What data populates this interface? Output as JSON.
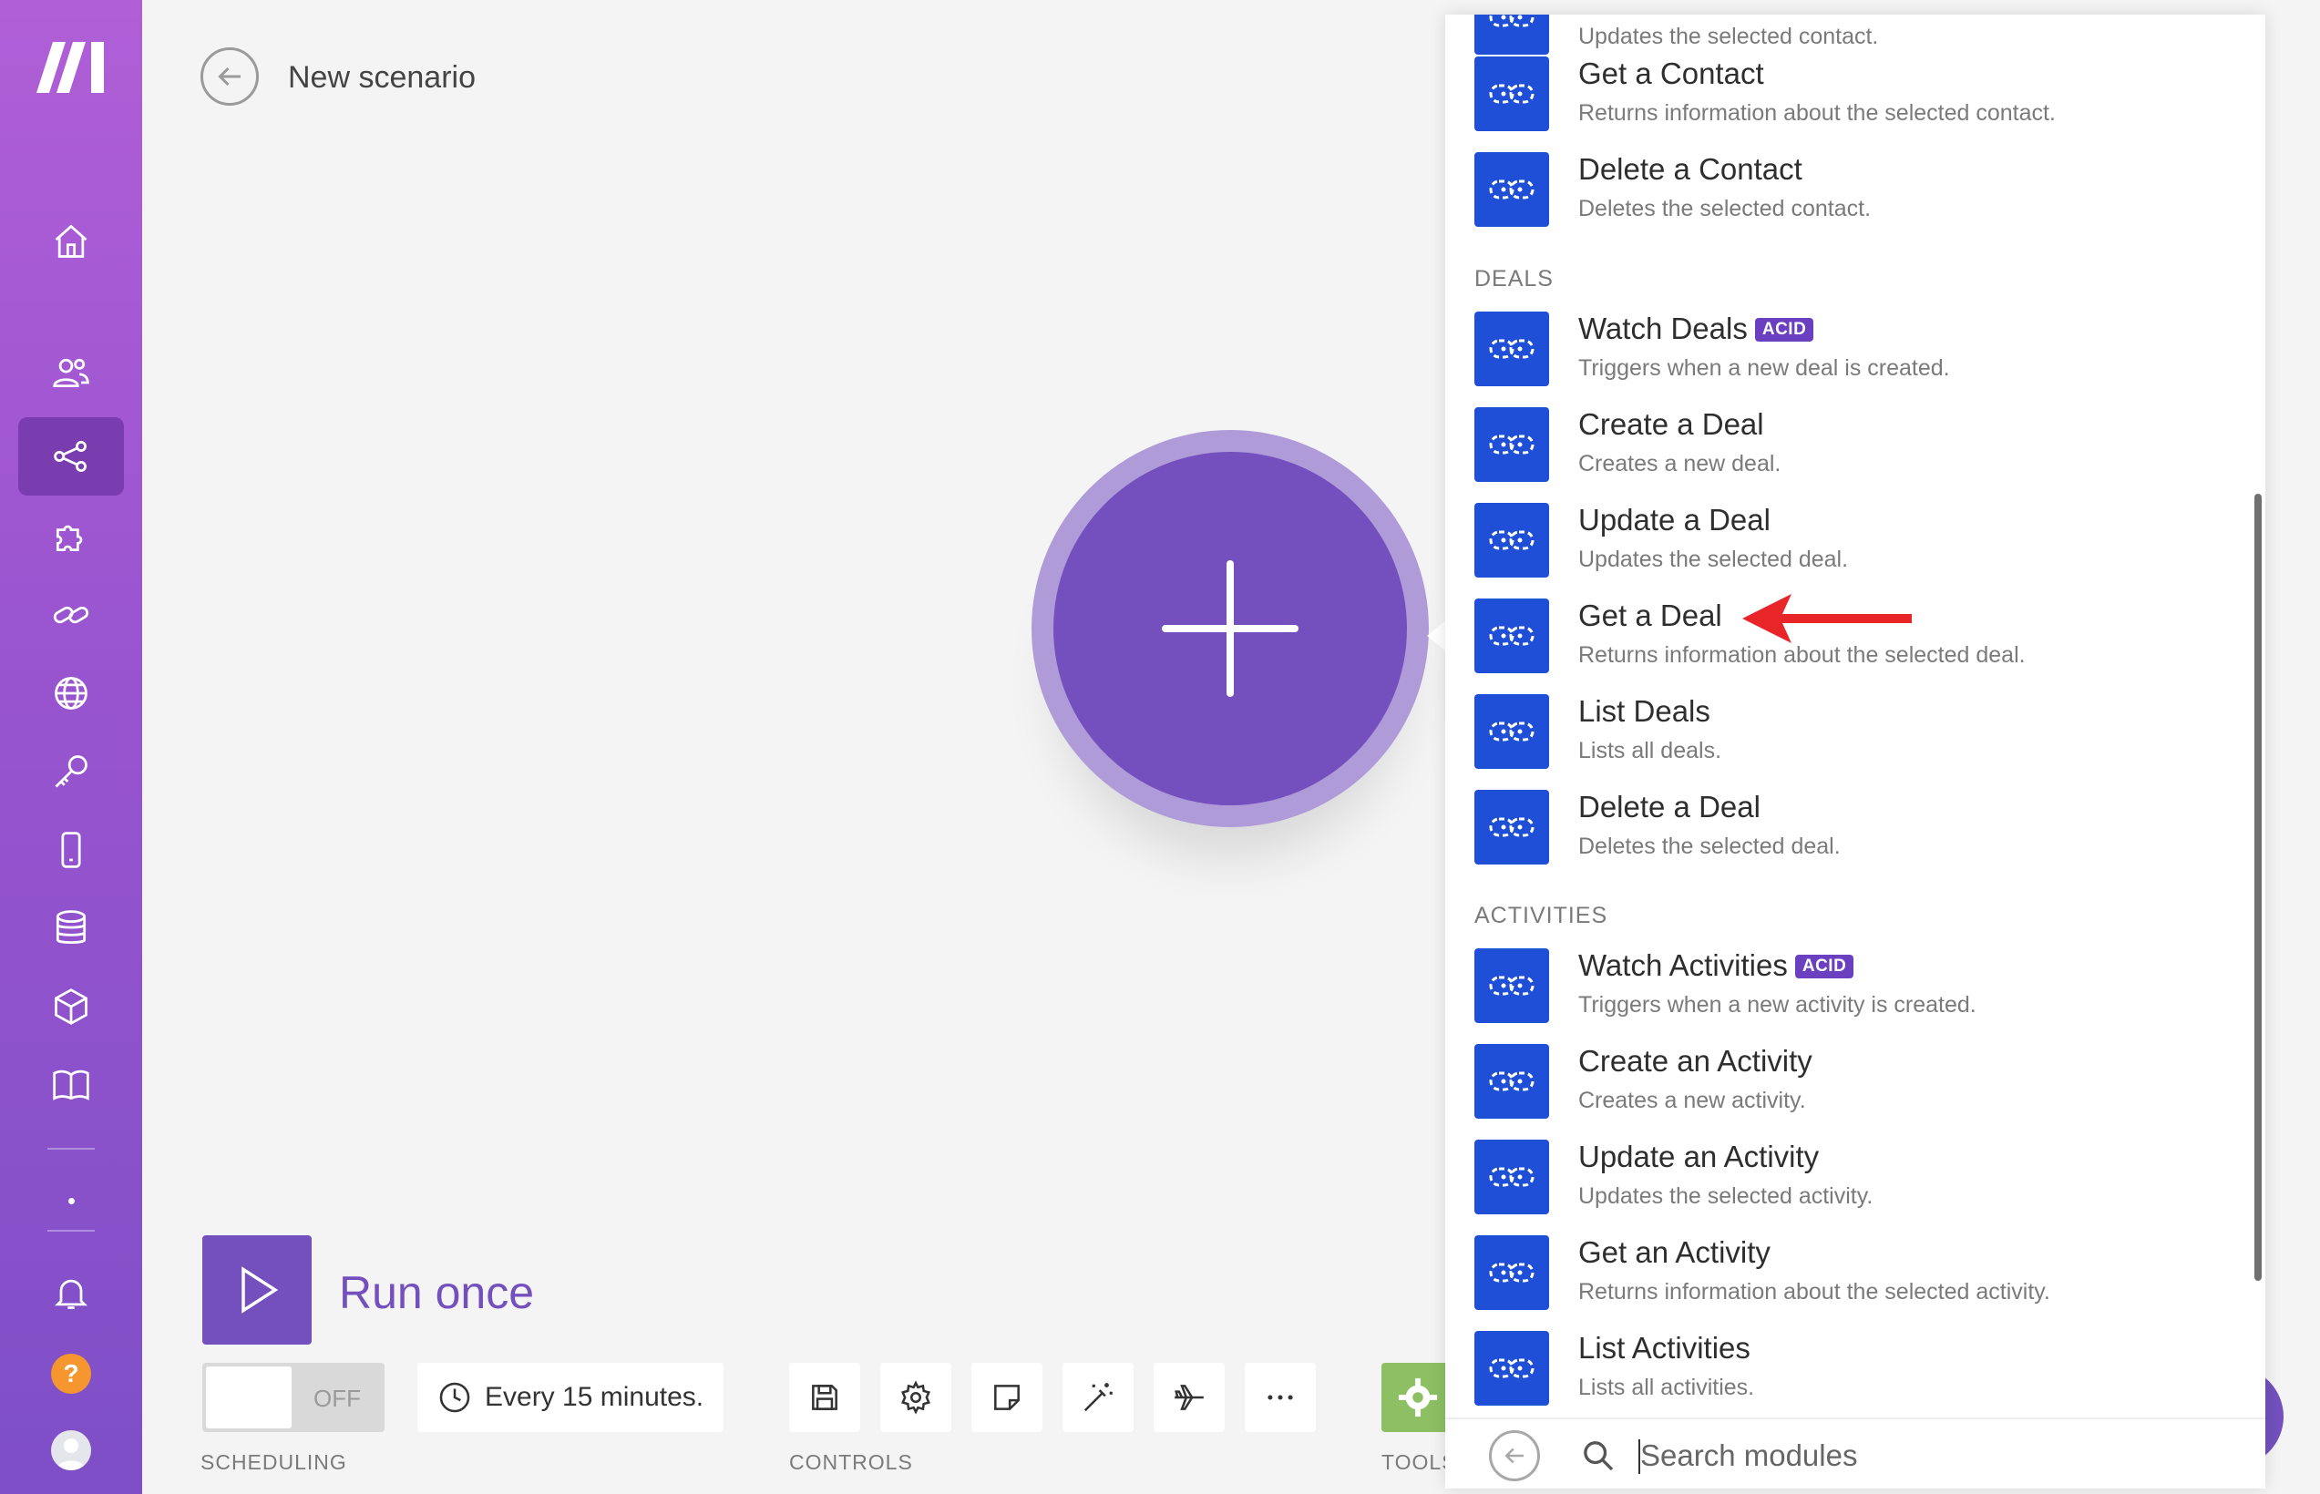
{
  "header": {
    "title": "New scenario"
  },
  "toolbar": {
    "run_label": "Run once",
    "scheduling_toggle": "OFF",
    "schedule_text": "Every 15 minutes.",
    "scheduling_label": "SCHEDULING",
    "controls_label": "CONTROLS",
    "tools_label": "TOOLS"
  },
  "panel": {
    "top_partial_desc": "Updates the selected contact.",
    "contact_modules": [
      {
        "name": "Get a Contact",
        "desc": "Returns information about the selected contact."
      },
      {
        "name": "Delete a Contact",
        "desc": "Deletes the selected contact."
      }
    ],
    "deals_header": "DEALS",
    "deals_modules": [
      {
        "name": "Watch Deals",
        "badge": "ACID",
        "desc": "Triggers when a new deal is created."
      },
      {
        "name": "Create a Deal",
        "desc": "Creates a new deal."
      },
      {
        "name": "Update a Deal",
        "desc": "Updates the selected deal."
      },
      {
        "name": "Get a Deal",
        "desc": "Returns information about the selected deal."
      },
      {
        "name": "List Deals",
        "desc": "Lists all deals."
      },
      {
        "name": "Delete a Deal",
        "desc": "Deletes the selected deal."
      }
    ],
    "activities_header": "ACTIVITIES",
    "activities_modules": [
      {
        "name": "Watch Activities",
        "badge": "ACID",
        "desc": "Triggers when a new activity is created."
      },
      {
        "name": "Create an Activity",
        "desc": "Creates a new activity."
      },
      {
        "name": "Update an Activity",
        "desc": "Updates the selected activity."
      },
      {
        "name": "Get an Activity",
        "desc": "Returns information about the selected activity."
      },
      {
        "name": "List Activities",
        "desc": "Lists all activities."
      }
    ],
    "search": {
      "placeholder": "Search modules"
    }
  },
  "sidebar": {
    "icons": [
      "home-icon",
      "team-icon",
      "scenarios-icon",
      "apps-icon",
      "connections-icon",
      "webhooks-icon",
      "keys-icon",
      "devices-icon",
      "data-stores-icon",
      "data-structures-icon",
      "docs-icon",
      "notifications-icon",
      "help-icon",
      "avatar"
    ],
    "help_glyph": "?"
  },
  "colors": {
    "brand_purple": "#7350bd",
    "module_blue": "#1e4fd6",
    "sidebar_top": "#b05fd6",
    "annotation_red": "#e8262a",
    "tools_green": "#8cc063"
  }
}
